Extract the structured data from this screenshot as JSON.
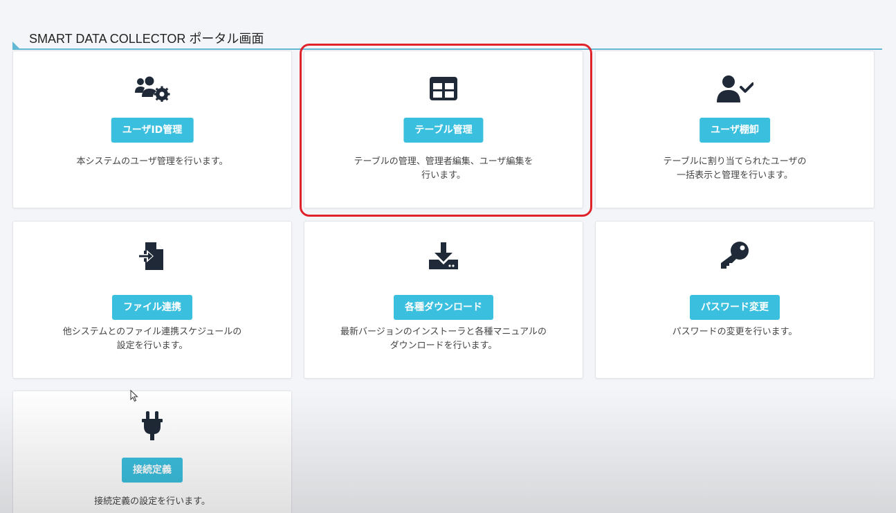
{
  "header": {
    "title": "SMART DATA COLLECTOR ポータル画面"
  },
  "colors": {
    "accent": "#3bbfde",
    "header_line": "#62b7d3",
    "highlight": "#e0222a",
    "icon": "#1f2937"
  },
  "cards": [
    {
      "icon": "users-cog-icon",
      "button": "ユーザID管理",
      "desc": [
        "本システムのユーザ管理を行います。"
      ]
    },
    {
      "icon": "table-icon",
      "button": "テーブル管理",
      "desc": [
        "テーブルの管理、管理者編集、ユーザ編集を",
        "行います。"
      ]
    },
    {
      "icon": "user-check-icon",
      "button": "ユーザ棚卸",
      "desc": [
        "テーブルに割り当てられたユーザの",
        "一括表示と管理を行います。"
      ]
    },
    {
      "icon": "file-import-icon",
      "button": "ファイル連携",
      "desc": [
        "他システムとのファイル連携スケジュールの",
        "設定を行います。"
      ]
    },
    {
      "icon": "download-icon",
      "button": "各種ダウンロード",
      "desc": [
        "最新バージョンのインストーラと各種マニュアルの",
        "ダウンロードを行います。"
      ]
    },
    {
      "icon": "key-icon",
      "button": "パスワード変更",
      "desc": [
        "パスワードの変更を行います。"
      ]
    },
    {
      "icon": "plug-icon",
      "button": "接続定義",
      "desc": [
        "接続定義の設定を行います。"
      ]
    }
  ]
}
